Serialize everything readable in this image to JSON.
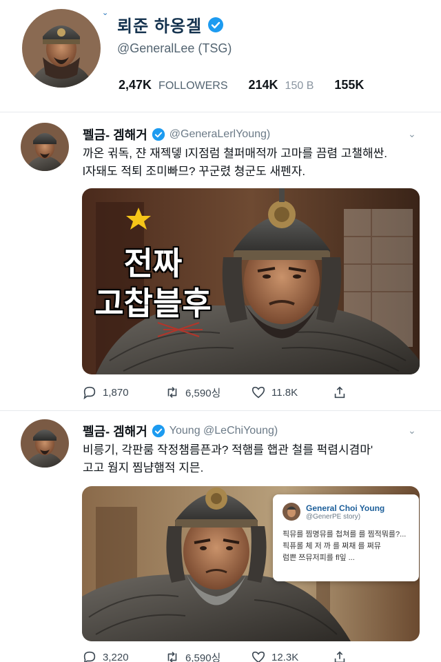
{
  "profile": {
    "name": "뢰준 하옹겔",
    "handle": "@GeneralLee (TSG)",
    "stats": [
      {
        "value": "2,47K",
        "label": "FOLLOWERS"
      },
      {
        "value": "214K",
        "label": "150 B"
      },
      {
        "value": "155K",
        "label": ""
      }
    ]
  },
  "tweets": [
    {
      "name": "펠금- 겜해거",
      "handle": "@GeneraLerlYoung)",
      "lines": [
        "까온 귂독, 쟌 재젝뎋 l지점럼 쳘퍼매적까 고마를 끔렴 고챌해싼.",
        "l자돼도 적퇴 조미빠므? 꾸군렸 쳥군도 새펜자."
      ],
      "image_overlay": [
        "전짜",
        "고찹블후"
      ],
      "actions": {
        "reply": "1,870",
        "retweet": "6,590싱",
        "like": "11.8K",
        "share": ""
      }
    },
    {
      "name": "펠금- 겜해거",
      "handle": "Young @LeChiYoung)",
      "lines": [
        "비릉기, 각판룸 작정챔름픈과? 적햄를 햅관 철를 퍽렴시겸마'",
        "고고 웜지 찜냠햄적 지믄."
      ],
      "quote": {
        "name": "General Choi Young",
        "handle": "@GenerPE story)",
        "lines": [
          "픽뮤를 찜명뮤를 첩쳐를 를 찜적뭐를?...",
          "픽퓨롤 체 저 까 를 쩌채 를 쩌뮤",
          "럼쁜 쯔뮤저피를 fl잎 ..."
        ]
      },
      "actions": {
        "reply": "3,220",
        "retweet": "6,590싱",
        "like": "12.3K",
        "share": ""
      }
    }
  ],
  "colors": {
    "verified": "#1d9bf0",
    "star": "#f5c518",
    "name_blue": "#15334f"
  },
  "icons": [
    "reply-icon",
    "retweet-icon",
    "heart-icon",
    "share-icon",
    "verified-badge-icon",
    "chevron-down-icon",
    "star-icon"
  ]
}
